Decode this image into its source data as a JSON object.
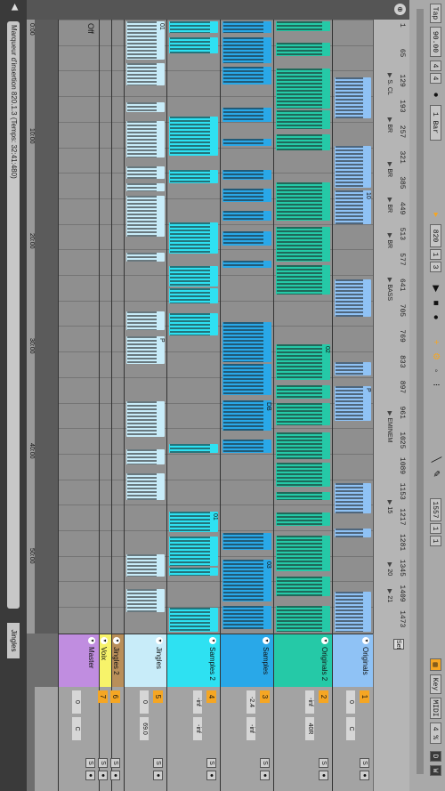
{
  "transport": {
    "tap": "Tap",
    "tempo": "90.00",
    "sig_num": "4",
    "sig_den": "4",
    "metro": "●",
    "quantize": "1 Bar",
    "arrangement_pos": "820",
    "pos_beat": "1",
    "pos_sixteenth": "3",
    "loop_start": "1557",
    "loop_beat": "1",
    "loop_six": "1",
    "key_label": "Key",
    "midi_label": "MIDI",
    "cpu": "4 %",
    "d_label": "D",
    "w_label": "W"
  },
  "ruler": {
    "bars": [
      "1",
      "65",
      "129",
      "193",
      "257",
      "321",
      "385",
      "449",
      "513",
      "577",
      "641",
      "705",
      "769",
      "833",
      "897",
      "961",
      "1025",
      "1089",
      "1153",
      "1217",
      "1281",
      "1345",
      "1409",
      "1473"
    ],
    "locators": [
      "S. CL",
      "BR",
      "BR",
      "BR",
      "BR",
      "BASS",
      "EMINEM",
      "15",
      "20",
      "21"
    ]
  },
  "time_marks": [
    "0:00",
    "10:00",
    "20:00",
    "30:00",
    "40:00",
    "50:00"
  ],
  "status": "Marqueur d'insertion 820.1.3 (Temps: 32:41:480)",
  "footer_tab": "Jingles",
  "off_label": "Off",
  "tracks": [
    {
      "name": "Originals",
      "color": "#8fc2f5",
      "num": "1",
      "vol": "0",
      "pan": "C",
      "height": 46
    },
    {
      "name": "Originals 2",
      "color": "#25c9a7",
      "num": "2",
      "vol": "-inf",
      "pan": "40R",
      "height": 66
    },
    {
      "name": "Samples",
      "color": "#29a8e8",
      "num": "3",
      "vol": "-2.4",
      "pan": "-inf",
      "height": 60
    },
    {
      "name": "Samples 2",
      "color": "#2ee1f2",
      "num": "4",
      "vol": "-inf",
      "pan": "-inf",
      "height": 60
    },
    {
      "name": "Jingles",
      "color": "#c8ecf9",
      "num": "5",
      "vol": "0",
      "pan": "69.0",
      "height": 48
    },
    {
      "name": "Jingles 2",
      "color": "#b98f5a",
      "num": "6",
      "vol": "",
      "pan": "",
      "height": 14
    },
    {
      "name": "Voix",
      "color": "#f7f36a",
      "num": "7",
      "vol": "",
      "pan": "",
      "height": 14
    },
    {
      "name": "Master",
      "color": "#c08de0",
      "num": "",
      "vol": "0",
      "pan": "C",
      "height": 46
    }
  ],
  "clip_labels": [
    "01",
    "02",
    "03",
    "07",
    "09",
    "10",
    "ERX",
    "SM Fiere",
    "Un Un Un",
    "DB",
    "P",
    "A.CIS"
  ]
}
